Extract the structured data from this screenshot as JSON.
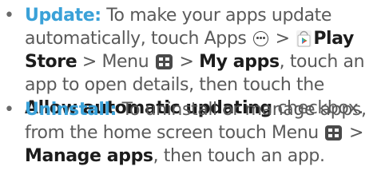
{
  "items": [
    {
      "bullet": "•",
      "term": "Update:",
      "lines": [
        [
          "To make your apps update"
        ],
        [
          "automatically, touch Apps",
          ">",
          "Play"
        ],
        [
          "Store",
          "> Menu",
          ">",
          "My apps",
          ", touch an"
        ],
        [
          "app to open details, then touch the"
        ],
        [
          "Allow automatic updating",
          "checkbox."
        ]
      ]
    },
    {
      "bullet": "•",
      "term": "Uninstall:",
      "lines": [
        [
          "To uninstall or manage apps,"
        ],
        [
          "from the home screen touch Menu",
          ">"
        ],
        [
          "Manage apps",
          ", then touch an app."
        ]
      ]
    }
  ],
  "icons": {
    "apps": "apps-icon",
    "store": "play-store-icon",
    "menu": "menu-icon"
  },
  "colors": {
    "term": "#3aa1d8",
    "text": "#5a5a5a",
    "strong": "#1c1c1c"
  }
}
